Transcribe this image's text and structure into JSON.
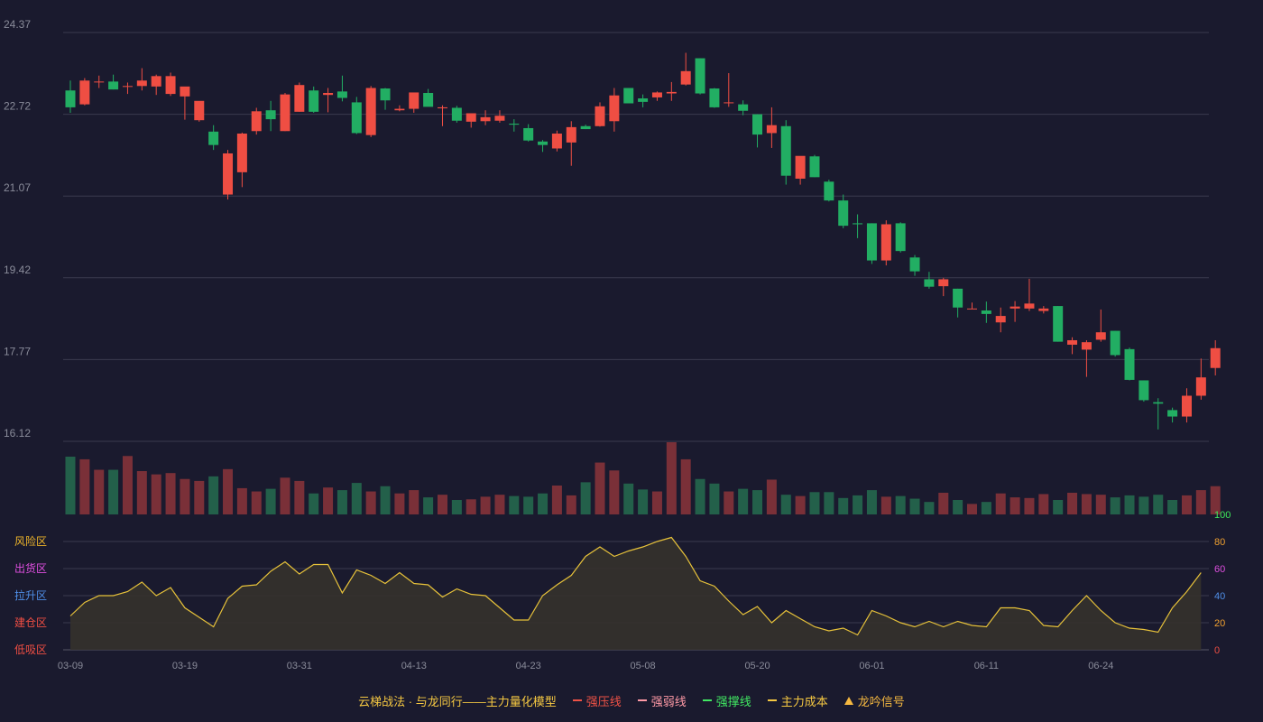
{
  "chart_data": [
    {
      "type": "candlestick",
      "ylim": [
        16.12,
        24.37
      ],
      "yticks": [
        "24.37",
        "22.72",
        "21.07",
        "19.42",
        "17.77",
        "16.12"
      ],
      "xticks": [
        {
          "index": 0,
          "label": "03-09"
        },
        {
          "index": 8,
          "label": "03-19"
        },
        {
          "index": 16,
          "label": "03-31"
        },
        {
          "index": 24,
          "label": "04-13"
        },
        {
          "index": 32,
          "label": "04-23"
        },
        {
          "index": 40,
          "label": "05-08"
        },
        {
          "index": 48,
          "label": "05-20"
        },
        {
          "index": 56,
          "label": "06-01"
        },
        {
          "index": 64,
          "label": "06-11"
        },
        {
          "index": 72,
          "label": "06-24"
        }
      ],
      "ohlc": [
        [
          23.2,
          23.4,
          22.75,
          22.86
        ],
        [
          22.92,
          23.45,
          22.9,
          23.4
        ],
        [
          23.38,
          23.5,
          23.25,
          23.38
        ],
        [
          23.38,
          23.52,
          23.22,
          23.22
        ],
        [
          23.29,
          23.36,
          23.13,
          23.29
        ],
        [
          23.29,
          23.65,
          23.2,
          23.4
        ],
        [
          23.28,
          23.52,
          23.11,
          23.49
        ],
        [
          23.13,
          23.56,
          23.09,
          23.49
        ],
        [
          23.08,
          23.26,
          22.61,
          23.28
        ],
        [
          22.6,
          22.78,
          22.57,
          22.99
        ],
        [
          22.37,
          22.5,
          22.0,
          22.1
        ],
        [
          21.1,
          22.0,
          21.0,
          21.93
        ],
        [
          21.55,
          22.35,
          21.25,
          22.33
        ],
        [
          22.38,
          22.85,
          22.31,
          22.78
        ],
        [
          22.8,
          22.99,
          22.38,
          22.62
        ],
        [
          22.38,
          23.15,
          22.38,
          23.12
        ],
        [
          22.77,
          23.36,
          22.77,
          23.31
        ],
        [
          23.2,
          23.28,
          22.75,
          22.77
        ],
        [
          23.11,
          23.25,
          22.76,
          23.15
        ],
        [
          23.18,
          23.5,
          22.98,
          23.05
        ],
        [
          22.96,
          23.07,
          22.32,
          22.34
        ],
        [
          22.3,
          23.29,
          22.26,
          23.25
        ],
        [
          23.24,
          23.25,
          22.81,
          23.0
        ],
        [
          22.8,
          22.9,
          22.78,
          22.83
        ],
        [
          22.83,
          23.13,
          22.75,
          23.16
        ],
        [
          23.15,
          23.23,
          22.88,
          22.87
        ],
        [
          22.84,
          22.9,
          22.48,
          22.86
        ],
        [
          22.85,
          22.89,
          22.55,
          22.59
        ],
        [
          22.57,
          22.7,
          22.45,
          22.74
        ],
        [
          22.58,
          22.8,
          22.5,
          22.66
        ],
        [
          22.59,
          22.8,
          22.55,
          22.69
        ],
        [
          22.53,
          22.62,
          22.37,
          22.51
        ],
        [
          22.44,
          22.52,
          22.17,
          22.19
        ],
        [
          22.17,
          22.2,
          21.96,
          22.1
        ],
        [
          22.03,
          22.39,
          21.97,
          22.33
        ],
        [
          22.15,
          22.58,
          21.68,
          22.46
        ],
        [
          22.48,
          22.51,
          22.42,
          22.42
        ],
        [
          22.48,
          22.96,
          22.47,
          22.88
        ],
        [
          22.58,
          23.25,
          22.37,
          23.1
        ],
        [
          23.25,
          23.25,
          23.0,
          22.94
        ],
        [
          23.04,
          23.12,
          22.86,
          22.97
        ],
        [
          23.06,
          23.18,
          22.99,
          23.16
        ],
        [
          23.14,
          23.37,
          22.99,
          23.17
        ],
        [
          23.32,
          23.96,
          23.3,
          23.59
        ],
        [
          23.85,
          23.85,
          23.12,
          23.14
        ],
        [
          23.24,
          23.25,
          22.85,
          22.86
        ],
        [
          22.96,
          23.55,
          22.87,
          22.96
        ],
        [
          22.92,
          23.0,
          22.7,
          22.79
        ],
        [
          22.72,
          22.72,
          22.05,
          22.31
        ],
        [
          22.34,
          22.86,
          22.04,
          22.5
        ],
        [
          22.48,
          22.6,
          21.3,
          21.48
        ],
        [
          21.42,
          21.86,
          21.3,
          21.88
        ],
        [
          21.87,
          21.9,
          21.45,
          21.45
        ],
        [
          21.36,
          21.4,
          20.96,
          20.98
        ],
        [
          20.98,
          21.1,
          20.42,
          20.47
        ],
        [
          20.52,
          20.7,
          20.22,
          20.5
        ],
        [
          20.52,
          20.52,
          19.7,
          19.77
        ],
        [
          19.77,
          20.58,
          19.67,
          20.5
        ],
        [
          20.52,
          20.54,
          19.93,
          19.96
        ],
        [
          19.83,
          19.88,
          19.46,
          19.55
        ],
        [
          19.39,
          19.54,
          19.2,
          19.24
        ],
        [
          19.25,
          19.42,
          19.05,
          19.39
        ],
        [
          19.2,
          19.2,
          18.62,
          18.82
        ],
        [
          18.8,
          18.92,
          18.79,
          18.8
        ],
        [
          18.76,
          18.94,
          18.51,
          18.69
        ],
        [
          18.52,
          18.82,
          18.32,
          18.65
        ],
        [
          18.8,
          18.95,
          18.53,
          18.84
        ],
        [
          18.8,
          19.4,
          18.75,
          18.9
        ],
        [
          18.75,
          18.85,
          18.7,
          18.8
        ],
        [
          18.85,
          18.85,
          18.13,
          18.13
        ],
        [
          18.07,
          18.22,
          17.88,
          18.16
        ],
        [
          17.97,
          18.16,
          17.42,
          18.12
        ],
        [
          18.17,
          18.78,
          18.13,
          18.32
        ],
        [
          18.35,
          18.35,
          17.83,
          17.86
        ],
        [
          17.98,
          18.01,
          17.35,
          17.36
        ],
        [
          17.35,
          17.35,
          16.92,
          16.95
        ],
        [
          16.91,
          16.99,
          16.36,
          16.88
        ],
        [
          16.75,
          16.8,
          16.5,
          16.62
        ],
        [
          16.62,
          17.19,
          16.5,
          17.04
        ],
        [
          17.04,
          17.79,
          16.96,
          17.41
        ],
        [
          17.6,
          18.16,
          17.45,
          18.0
        ]
      ]
    },
    {
      "type": "bar",
      "volume": [
        88,
        84,
        68,
        68,
        89,
        66,
        61,
        63,
        54,
        51,
        58,
        69,
        40,
        35,
        39,
        56,
        51,
        32,
        41,
        37,
        48,
        35,
        43,
        32,
        37,
        26,
        30,
        22,
        23,
        27,
        30,
        28,
        27,
        32,
        44,
        29,
        49,
        79,
        67,
        47,
        38,
        35,
        110,
        84,
        54,
        47,
        35,
        39,
        37,
        53,
        30,
        28,
        34,
        34,
        25,
        29,
        37,
        27,
        28,
        24,
        19,
        33,
        22,
        16,
        19,
        32,
        26,
        25,
        31,
        22,
        33,
        31,
        30,
        26,
        29,
        27,
        30,
        22,
        29,
        37,
        43
      ]
    },
    {
      "type": "area",
      "ylim": [
        0,
        100
      ],
      "yticks": [
        "100",
        "80",
        "60",
        "40",
        "20",
        "0"
      ],
      "zones": [
        "风险区",
        "出货区",
        "拉升区",
        "建仓区",
        "低吸区"
      ],
      "values": [
        25,
        35,
        40,
        40,
        43,
        50,
        40,
        46,
        31,
        24,
        17,
        38,
        47,
        48,
        58,
        65,
        56,
        63,
        63,
        42,
        59,
        55,
        49,
        57,
        49,
        48,
        39,
        45,
        41,
        40,
        31,
        22,
        22,
        40,
        48,
        55,
        69,
        76,
        69,
        73,
        76,
        80,
        83,
        69,
        51,
        47,
        36,
        26,
        32,
        20,
        29,
        23,
        17,
        14,
        16,
        11,
        29,
        25,
        20,
        17,
        21,
        17,
        21,
        18,
        17,
        31,
        31,
        29,
        18,
        17,
        29,
        40,
        29,
        20,
        16,
        15,
        13,
        31,
        43,
        57
      ]
    }
  ],
  "legend": {
    "title": "云梯战法 · 与龙同行——主力量化模型",
    "items": [
      {
        "label": "强压线",
        "color": "#ef5246",
        "style": "solid"
      },
      {
        "label": "强弱线",
        "color": "#ff9aa6",
        "style": "dashed"
      },
      {
        "label": "强撑线",
        "color": "#41e862",
        "style": "solid"
      },
      {
        "label": "主力成本",
        "color": "#f5c842",
        "style": "dashed"
      },
      {
        "label": "龙吟信号",
        "color": "#f5b840",
        "style": "triangle"
      }
    ]
  },
  "colors": {
    "background": "#1a1a2e",
    "up": "#ef4e43",
    "down": "#22ae63",
    "volume_up": "#7a3038",
    "volume_down": "#23604a",
    "grid": "#3a3a4e",
    "axis_text": "#8a8c9a",
    "indicator_line": "#e7c23a",
    "indicator_fill": "#35322c",
    "zone_colors": [
      "#f0b62a",
      "#df4fe0",
      "#4f8fe8",
      "#ef4e43",
      "#ef4e43"
    ],
    "tick_colors": [
      "#3ee85a",
      "#f0a030",
      "#df4fe0",
      "#4f8fe8",
      "#f0a030",
      "#ef4e43"
    ]
  }
}
